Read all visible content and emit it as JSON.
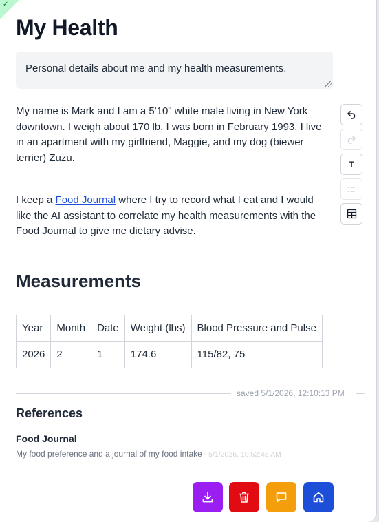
{
  "page": {
    "title": "My Health",
    "description": "Personal details about me and my health measurements.",
    "intro_paragraph": "My name is Mark and I am a 5'10\" white male living in New York downtown. I weigh about 170 lb. I was born in February 1993. I live in an apartment with my girlfriend, Maggie, and my dog (biewer terrier) Zuzu.",
    "journal_before": "I keep a ",
    "journal_link": "Food Journal",
    "journal_after": " where I try to record what I eat and I would like the AI assistant to correlate my health measurements with the Food Journal to give me dietary advise."
  },
  "toolbar": {
    "undo_icon": "undo-icon",
    "redo_icon": "redo-icon",
    "text_label": "T",
    "list_icon": "list-icon",
    "table_icon": "table-icon"
  },
  "measurements": {
    "heading": "Measurements",
    "columns": [
      "Year",
      "Month",
      "Date",
      "Weight (lbs)",
      "Blood Pressure and Pulse"
    ],
    "rows": [
      [
        "2026",
        "2",
        "1",
        "174.6",
        "115/82, 75"
      ]
    ]
  },
  "status": {
    "saved": "saved 5/1/2026, 12:10:13 PM"
  },
  "references": {
    "heading": "References",
    "items": [
      {
        "title": "Food Journal",
        "description": "My food preference and a journal of my food intake",
        "date": " - 5/1/2026, 10:52:45 AM"
      }
    ]
  },
  "actions": {
    "download_icon": "download-icon",
    "delete_icon": "trash-icon",
    "chat_icon": "chat-icon",
    "home_icon": "home-icon"
  },
  "colors": {
    "download": "#9b1ff2",
    "delete": "#e30b12",
    "chat": "#f59e0b",
    "home": "#1d4ed8",
    "link": "#1d4ed8",
    "badge": "#bbf7d0"
  }
}
